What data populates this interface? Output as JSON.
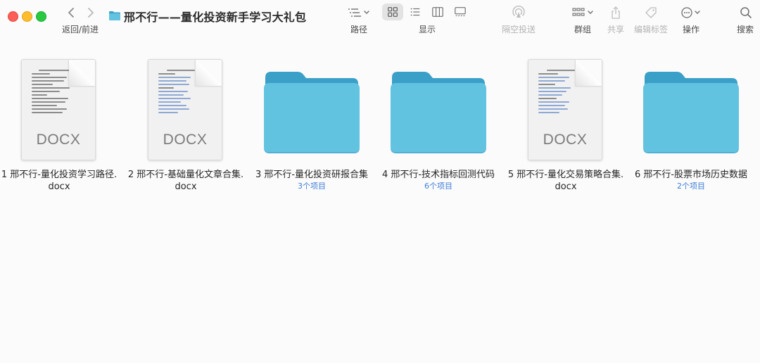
{
  "window": {
    "title": "邢不行——量化投资新手学习大礼包",
    "nav_label": "返回/前进"
  },
  "toolbar": {
    "path_label": "路径",
    "view_label": "显示",
    "airdrop_label": "隔空投送",
    "group_label": "群组",
    "share_label": "共享",
    "tags_label": "编辑标签",
    "action_label": "操作",
    "search_label": "搜索"
  },
  "items": [
    {
      "name": "1 邢不行-量化投资学习路径.docx",
      "type": "docx",
      "ext_label": "DOCX",
      "count": ""
    },
    {
      "name": "2 邢不行-基础量化文章合集.docx",
      "type": "docx",
      "ext_label": "DOCX",
      "count": ""
    },
    {
      "name": "3 邢不行-量化投资研报合集",
      "type": "folder",
      "count": "3个项目"
    },
    {
      "name": "4 邢不行-技术指标回测代码",
      "type": "folder",
      "count": "6个项目"
    },
    {
      "name": "5 邢不行-量化交易策略合集.docx",
      "type": "docx",
      "ext_label": "DOCX",
      "count": ""
    },
    {
      "name": "6 邢不行-股票市场历史数据",
      "type": "folder",
      "count": "2个项目"
    }
  ],
  "colors": {
    "folder_front": "#62c3e0",
    "folder_back": "#3aa0c8",
    "count_text": "#3f7ed8",
    "close": "#fe5f57",
    "minimize": "#febc2e",
    "zoom": "#28c840"
  }
}
